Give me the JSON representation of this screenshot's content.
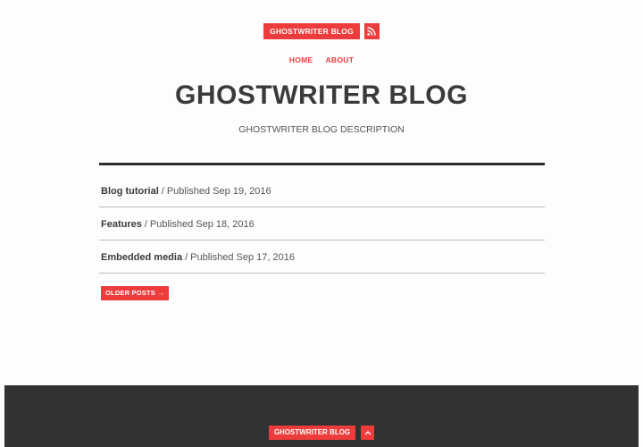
{
  "header": {
    "brand_label": "GHOSTWRITER BLOG",
    "rss_icon": "rss-icon",
    "nav": [
      {
        "label": "HOME"
      },
      {
        "label": "ABOUT"
      }
    ],
    "title": "GHOSTWRITER BLOG",
    "description": "GHOSTWRITER BLOG DESCRIPTION"
  },
  "posts": [
    {
      "title": "Blog tutorial",
      "meta": "Published Sep 19, 2016"
    },
    {
      "title": "Features",
      "meta": "Published Sep 18, 2016"
    },
    {
      "title": "Embedded media",
      "meta": "Published Sep 17, 2016"
    }
  ],
  "post_separator": "/",
  "pagination": {
    "older_label": "OLDER POSTS →"
  },
  "footer": {
    "brand_label": "GHOSTWRITER BLOG",
    "top_icon": "chevron-up-icon"
  },
  "colors": {
    "accent": "#ec3c3c",
    "footer_bg": "#323232",
    "text": "#3a3a3a"
  }
}
